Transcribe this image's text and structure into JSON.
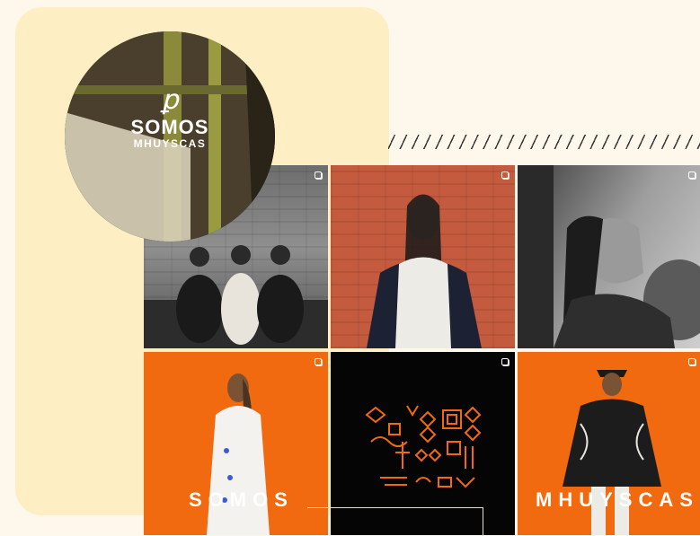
{
  "brand": {
    "logo_line1": "SOMOS",
    "logo_line2": "MHUYSCAS",
    "logo_mark": "ꝑ"
  },
  "tiles": [
    {
      "name": "group-of-three",
      "alt": ""
    },
    {
      "name": "woman-red-wall",
      "alt": ""
    },
    {
      "name": "man-profile-bw",
      "alt": ""
    },
    {
      "name": "model-white-ruana",
      "word": "SOMOS"
    },
    {
      "name": "orange-symbols-art"
    },
    {
      "name": "model-black-ruana",
      "word": "MHUYSCAS"
    }
  ],
  "colors": {
    "accent_orange": "#f26a0f",
    "panel_yellow": "#fdeec3",
    "background": "#fdf7ec"
  }
}
